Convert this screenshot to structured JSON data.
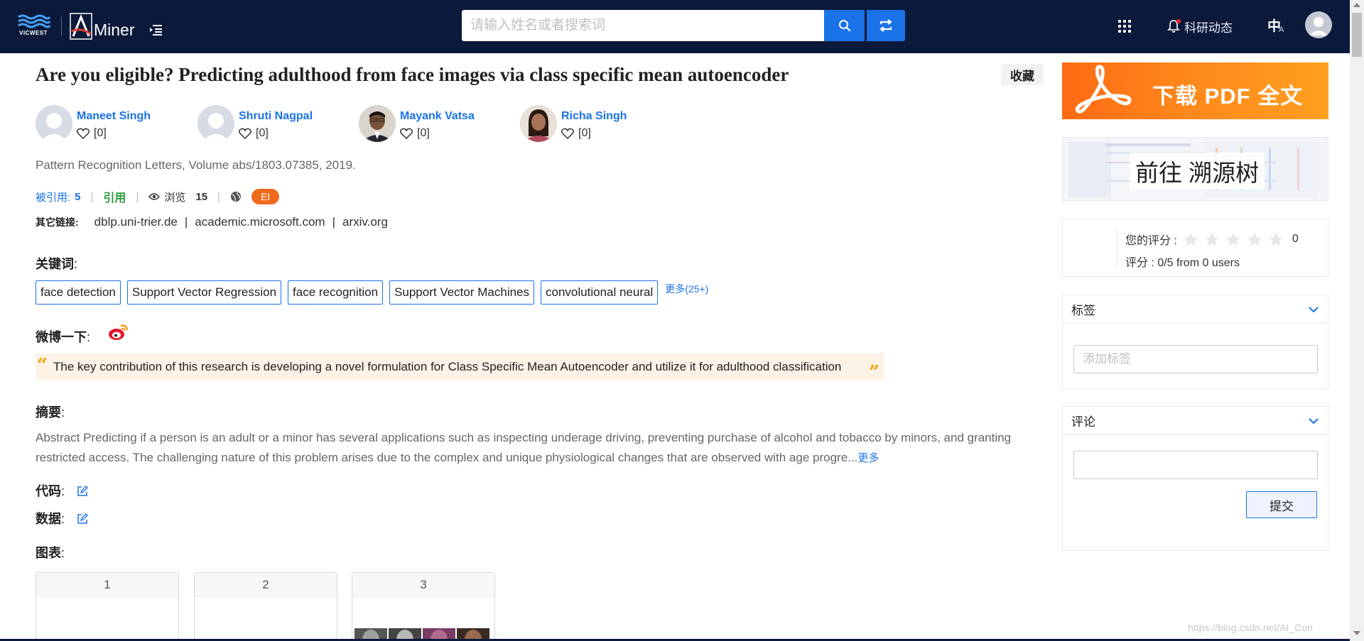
{
  "navbar": {
    "vicwest_logo_text": "VICWEST",
    "aminer_logo_text": "Miner",
    "search_placeholder": "请输入姓名或者搜索词",
    "news_label": "科研动态",
    "lang_zh": "中",
    "lang_en": "A"
  },
  "paper": {
    "title": "Are you eligible? Predicting adulthood from face images via class specific mean autoencoder",
    "collect_label": "收藏",
    "authors": [
      {
        "name": "Maneet Singh",
        "likes": "[0]"
      },
      {
        "name": "Shruti Nagpal",
        "likes": "[0]"
      },
      {
        "name": "Mayank Vatsa",
        "likes": "[0]"
      },
      {
        "name": "Richa Singh",
        "likes": "[0]"
      }
    ],
    "venue": "Pattern Recognition Letters, Volume abs/1803.07385, 2019.",
    "stats": {
      "cited_label": "被引用:",
      "cited_count": "5",
      "quote_label": "引用",
      "view_label": "浏览",
      "view_count": "15",
      "badge": "EI"
    },
    "other_links": {
      "label": "其它链接:",
      "links": [
        "dblp.uni-trier.de",
        "academic.microsoft.com",
        "arxiv.org"
      ]
    },
    "keywords_label": "关键词",
    "keywords": [
      "face detection",
      "Support Vector Regression",
      "face recognition",
      "Support Vector Machines",
      "convolutional neural"
    ],
    "keywords_more": "更多(25+)",
    "weibo_label": "微博一下",
    "quote_text": "The key contribution of this research is developing a novel formulation for Class Specific Mean Autoencoder and utilize it for adulthood classification",
    "abstract_label": "摘要",
    "abstract_text": "Abstract Predicting if a person is an adult or a minor has several applications such as inspecting underage driving, preventing purchase of alcohol and tobacco by minors, and granting restricted access. The challenging nature of this problem arises due to the complex and unique physiological changes that are observed with age progre...",
    "abstract_more": "更多",
    "code_label": "代码",
    "data_label": "数据",
    "figures_label": "图表",
    "figures": [
      "1",
      "2",
      "3"
    ]
  },
  "sidebar": {
    "pdf_label": "下载 PDF 全文",
    "tree_label": "前往 溯源树",
    "rating": {
      "your_rating_label": "您的评分 :",
      "your_rating_value": "0",
      "summary": "评分 : 0/5 from 0 users"
    },
    "tags": {
      "title": "标签",
      "placeholder": "添加标签"
    },
    "comments": {
      "title": "评论",
      "submit_label": "提交"
    }
  },
  "watermark": "https://blog.csdn.net/AI_Con"
}
